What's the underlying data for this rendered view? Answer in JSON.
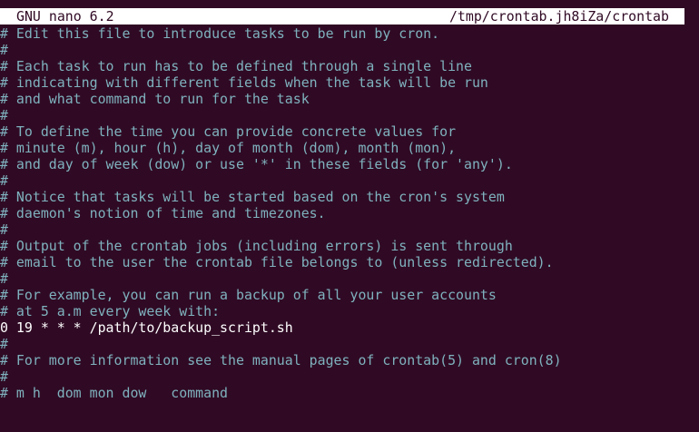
{
  "titlebar": {
    "app_name": "GNU nano 6.2",
    "file_path": "/tmp/crontab.jh8iZa/crontab"
  },
  "lines": [
    {
      "text": "# Edit this file to introduce tasks to be run by cron.",
      "kind": "comment"
    },
    {
      "text": "#",
      "kind": "comment"
    },
    {
      "text": "# Each task to run has to be defined through a single line",
      "kind": "comment"
    },
    {
      "text": "# indicating with different fields when the task will be run",
      "kind": "comment"
    },
    {
      "text": "# and what command to run for the task",
      "kind": "comment"
    },
    {
      "text": "#",
      "kind": "comment"
    },
    {
      "text": "# To define the time you can provide concrete values for",
      "kind": "comment"
    },
    {
      "text": "# minute (m), hour (h), day of month (dom), month (mon),",
      "kind": "comment"
    },
    {
      "text": "# and day of week (dow) or use '*' in these fields (for 'any').",
      "kind": "comment"
    },
    {
      "text": "#",
      "kind": "comment"
    },
    {
      "text": "# Notice that tasks will be started based on the cron's system",
      "kind": "comment"
    },
    {
      "text": "# daemon's notion of time and timezones.",
      "kind": "comment"
    },
    {
      "text": "#",
      "kind": "comment"
    },
    {
      "text": "# Output of the crontab jobs (including errors) is sent through",
      "kind": "comment"
    },
    {
      "text": "# email to the user the crontab file belongs to (unless redirected).",
      "kind": "comment"
    },
    {
      "text": "#",
      "kind": "comment"
    },
    {
      "text": "# For example, you can run a backup of all your user accounts",
      "kind": "comment"
    },
    {
      "text": "# at 5 a.m every week with:",
      "kind": "comment"
    },
    {
      "text": "0 19 * * * /path/to/backup_script.sh",
      "kind": "code"
    },
    {
      "text": "#",
      "kind": "comment"
    },
    {
      "text": "# For more information see the manual pages of crontab(5) and cron(8)",
      "kind": "comment"
    },
    {
      "text": "#",
      "kind": "comment"
    },
    {
      "text": "# m h  dom mon dow   command",
      "kind": "comment"
    }
  ],
  "colors": {
    "background": "#300a24",
    "comment": "#7fb2be",
    "code": "#ffffff",
    "titlebar_bg": "#ffffff",
    "titlebar_fg": "#300a24"
  }
}
